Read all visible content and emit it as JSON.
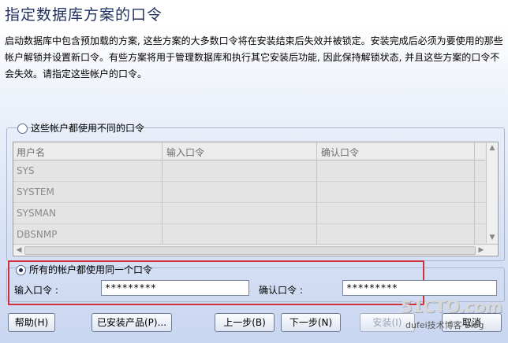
{
  "page": {
    "title": "指定数据库方案的口令",
    "description": "启动数据库中包含预加载的方案, 这些方案的大多数口令将在安装结束后失效并被锁定。安装完成后必须为要使用的那些帐户解锁并设置新口令。有些方案将用于管理数据库和执行其它安装后功能, 因此保持解锁状态, 并且这些方案的口令不会失效。请指定这些帐户的口令。"
  },
  "option_different": {
    "label": "这些帐户都使用不同的口令",
    "selected": false
  },
  "table": {
    "columns": [
      "用户名",
      "输入口令",
      "确认口令"
    ],
    "rows": [
      {
        "username": "SYS"
      },
      {
        "username": "SYSTEM"
      },
      {
        "username": "SYSMAN"
      },
      {
        "username": "DBSNMP"
      }
    ]
  },
  "option_same": {
    "label": "所有的帐户都使用同一个口令",
    "selected": true,
    "password_label": "输入口令 :",
    "password_value": "*********",
    "confirm_label": "确认口令 :",
    "confirm_value": "*********"
  },
  "buttons": {
    "help": "帮助(H)",
    "installed": "已安装产品(P)...",
    "back": "上一步(B)",
    "next": "下一步(N)",
    "install": "安装(I)",
    "cancel": "取消"
  },
  "watermark": {
    "logo": "51CTO.com",
    "sub": "dufei技术博客 Blog"
  }
}
